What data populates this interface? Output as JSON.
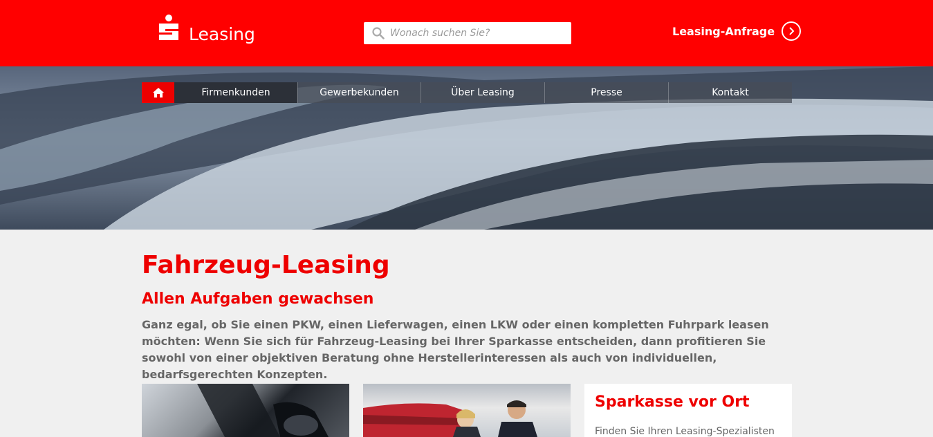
{
  "header": {
    "logo_text": "Leasing",
    "search": {
      "placeholder": "Wonach suchen Sie?"
    },
    "request_link": "Leasing-Anfrage",
    "brand_color": "#ff0000"
  },
  "nav": {
    "items": [
      {
        "label": "Firmenkunden",
        "active": true
      },
      {
        "label": "Gewerbekunden"
      },
      {
        "label": "Über Leasing"
      },
      {
        "label": "Presse"
      },
      {
        "label": "Kontakt"
      }
    ]
  },
  "main": {
    "title": "Fahrzeug-Leasing",
    "subtitle": "Allen Aufgaben gewachsen",
    "intro": "Ganz egal, ob Sie einen PKW, einen Lieferwagen, einen LKW oder einen kompletten Fuhrpark leasen möchten: Wenn Sie sich für Fahrzeug-Leasing bei Ihrer Sparkasse entscheiden, dann profitieren Sie sowohl von einer objektiven Beratung ohne Herstellerinteressen als auch von individuellen, bedarfsgerechten Konzepten."
  },
  "cards": {
    "local": {
      "title": "Sparkasse vor Ort",
      "text": "Finden Sie Ihren Leasing-Spezialisten"
    }
  },
  "icons": {
    "logo": "sparkasse-logo",
    "search": "search-icon",
    "arrow": "chevron-right-icon",
    "home": "home-icon"
  }
}
